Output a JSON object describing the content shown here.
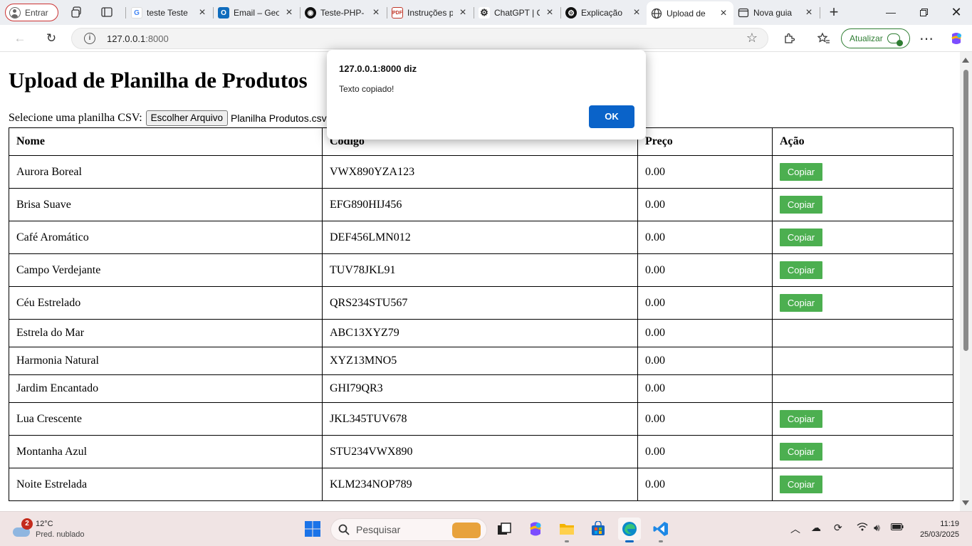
{
  "browser": {
    "profile_label": "Entrar",
    "tabs": [
      {
        "title": "teste Teste",
        "icon": "google-icon"
      },
      {
        "title": "Email – Geo",
        "icon": "outlook-icon"
      },
      {
        "title": "Teste-PHP-",
        "icon": "github-icon"
      },
      {
        "title": "Instruções p",
        "icon": "pdf-icon"
      },
      {
        "title": "ChatGPT | C",
        "icon": "chatgpt-icon"
      },
      {
        "title": "Explicação",
        "icon": "chatgpt-icon"
      },
      {
        "title": "Upload de",
        "icon": "globe-icon"
      },
      {
        "title": "Nova guia",
        "icon": "newtab-icon"
      }
    ],
    "url_host": "127.0.0.1",
    "url_port": ":8000",
    "update_label": "Atualizar"
  },
  "page": {
    "heading": "Upload de Planilha de Produtos",
    "upload_label": "Selecione uma planilha CSV:",
    "file_button": "Escolher Arquivo",
    "file_name": "Planilha Produtos.csv",
    "columns": [
      "Nome",
      "Código",
      "Preço",
      "Ação"
    ],
    "copy_label": "Copiar",
    "rows": [
      {
        "nome": "Aurora Boreal",
        "codigo": "VWX890YZA123",
        "preco": "0.00",
        "has_button": true
      },
      {
        "nome": "Brisa Suave",
        "codigo": "EFG890HIJ456",
        "preco": "0.00",
        "has_button": true
      },
      {
        "nome": "Café Aromático",
        "codigo": "DEF456LMN012",
        "preco": "0.00",
        "has_button": true
      },
      {
        "nome": "Campo Verdejante",
        "codigo": "TUV78JKL91",
        "preco": "0.00",
        "has_button": true
      },
      {
        "nome": "Céu Estrelado",
        "codigo": "QRS234STU567",
        "preco": "0.00",
        "has_button": true
      },
      {
        "nome": "Estrela do Mar",
        "codigo": "ABC13XYZ79",
        "preco": "0.00",
        "has_button": false
      },
      {
        "nome": "Harmonia Natural",
        "codigo": "XYZ13MNO5",
        "preco": "0.00",
        "has_button": false
      },
      {
        "nome": "Jardim Encantado",
        "codigo": "GHI79QR3",
        "preco": "0.00",
        "has_button": false
      },
      {
        "nome": "Lua Crescente",
        "codigo": "JKL345TUV678",
        "preco": "0.00",
        "has_button": true
      },
      {
        "nome": "Montanha Azul",
        "codigo": "STU234VWX890",
        "preco": "0.00",
        "has_button": true
      },
      {
        "nome": "Noite Estrelada",
        "codigo": "KLM234NOP789",
        "preco": "0.00",
        "has_button": true
      }
    ]
  },
  "dialog": {
    "title": "127.0.0.1:8000 diz",
    "message": "Texto copiado!",
    "ok_label": "OK"
  },
  "taskbar": {
    "weather_badge": "2",
    "weather_temp": "12°C",
    "weather_desc": "Pred. nublado",
    "search_label": "Pesquisar",
    "time": "11:19",
    "date": "25/03/2025"
  },
  "colors": {
    "copy_button": "#4caf50",
    "dialog_ok": "#0a63c9",
    "update_green": "#2e7d32"
  }
}
